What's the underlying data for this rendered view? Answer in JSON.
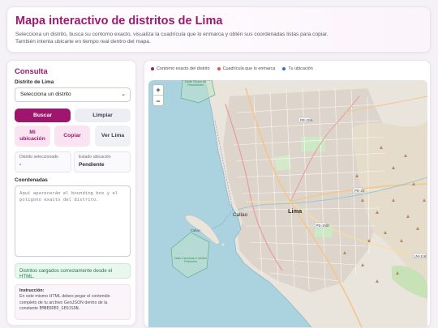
{
  "header": {
    "title": "Mapa interactivo de distritos de Lima",
    "subtitle": "Selecciona un distrito, busca su contorno exacto, visualiza la cuadrícula que lo enmarca y obtén sus coordenadas listas para copiar. También intenta ubicarte en tiempo real dentro del mapa."
  },
  "panel": {
    "title": "Consulta",
    "district_label": "Distrito de Lima",
    "district_select": "Selecciona un distrito",
    "buttons": {
      "search": "Buscar",
      "clear": "Limpiar",
      "my_location": "Mi ubicación",
      "copy": "Copiar",
      "view_lima": "Ver Lima"
    },
    "selected": {
      "label": "Distrito seleccionado",
      "value": "-"
    },
    "location_status": {
      "label": "Estado ubicación",
      "value": "Pendiente"
    },
    "coords_label": "Coordenadas",
    "coords_placeholder": "Aquí aparecerán el bounding box y el polígono exacto del distrito.",
    "success_message": "Distritos cargados correctamente desde el HTML.",
    "note_title": "Instrucción:",
    "note_text": "En este mismo HTML debes pegar el contenido completo de tu archivo GeoJSON dentro de la constante",
    "note_code": "EMBEDDED_GEOJSON."
  },
  "legend": [
    {
      "label": "Contorno exacto del distrito",
      "color": "#a0166f"
    },
    {
      "label": "Cuadrícula que lo enmarca",
      "color": "#e0524f"
    },
    {
      "label": "Tu ubicación",
      "color": "#2f6fd6"
    }
  ],
  "map": {
    "zoom_in": "+",
    "zoom_out": "−",
    "labels": {
      "callao": "Callao",
      "lima": "Lima",
      "island": "Callao",
      "reserve_north": "Islote Grupo de Pescadores",
      "reserve_south": "Islas Cavinzas e Islotes Palomino",
      "road_pe20a": "PE-20A",
      "road_pe22": "PE-22",
      "road_pe1ns": "PE-1NS",
      "road_lm116": "LM-116"
    }
  }
}
